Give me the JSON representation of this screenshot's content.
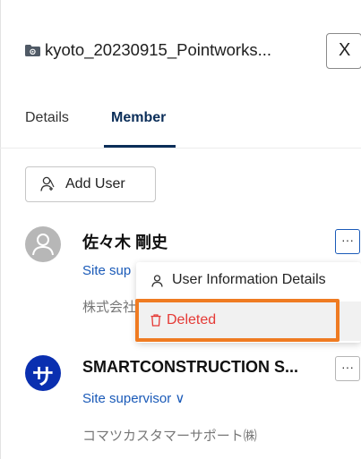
{
  "header": {
    "title": "kyoto_20230915_Pointworks...",
    "close_label": "X"
  },
  "tabs": [
    {
      "label": "Details"
    },
    {
      "label": "Member"
    }
  ],
  "add_user_label": "Add User",
  "members": [
    {
      "name": "佐々木 剛史",
      "role": "Site sup",
      "company": "株式会社",
      "more_label": "···"
    },
    {
      "name": "SMARTCONSTRUCTION S...",
      "role": "Site supervisor ∨",
      "company": "コマツカスタマーサポート㈱",
      "avatar_char": "サ",
      "more_label": "···"
    }
  ],
  "menu": {
    "items": [
      {
        "label": "User Information Details",
        "icon": "person-icon"
      },
      {
        "label": "Deleted",
        "icon": "trash-icon"
      }
    ]
  },
  "colors": {
    "accent": "#0b2e59",
    "link": "#1a5ab8",
    "danger": "#e53935",
    "highlight": "#ef7b22"
  }
}
